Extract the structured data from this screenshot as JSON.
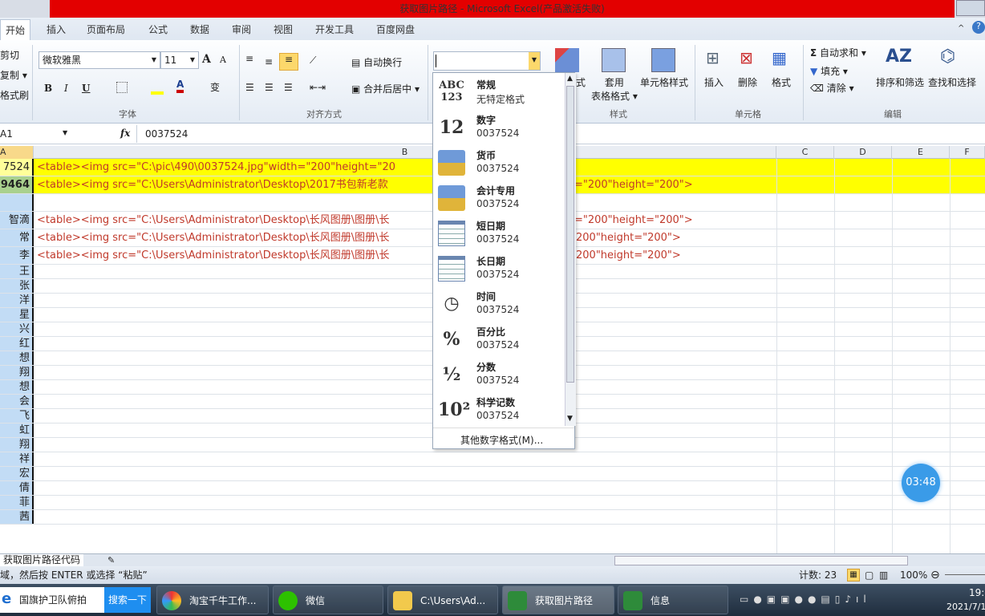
{
  "window": {
    "title": "获取图片路径 - Microsoft Excel(产品激活失败)"
  },
  "tabs": [
    "开始",
    "插入",
    "页面布局",
    "公式",
    "数据",
    "审阅",
    "视图",
    "开发工具",
    "百度网盘"
  ],
  "ribbon": {
    "clipboard": {
      "cut": "剪切",
      "copy": "复制 ▾",
      "format_painter": "格式刷"
    },
    "font": {
      "name": "微软雅黑",
      "size": "11",
      "group": "字体",
      "bold": "B",
      "italic": "I",
      "underline": "U"
    },
    "alignment": {
      "wrap": "自动换行",
      "merge": "合并后居中 ▾",
      "group": "对齐方式"
    },
    "number": {
      "format_value": ""
    },
    "styles": {
      "conditional": "式",
      "table": "套用\n表格格式 ▾",
      "cell": "单元格样式",
      "group": "样式"
    },
    "cells": {
      "insert": "插入",
      "delete": "删除",
      "format": "格式",
      "group": "单元格"
    },
    "editing": {
      "autosum": "自动求和 ▾",
      "fill": "填充 ▾",
      "clear": "清除 ▾",
      "sort": "排序和筛选",
      "find": "查找和选择",
      "group": "编辑"
    }
  },
  "formula_bar": {
    "name_box": "A1",
    "fx": "fx",
    "value": "0037524"
  },
  "columns": [
    "A",
    "B",
    "C",
    "D",
    "E",
    "F"
  ],
  "rows": [
    {
      "a": "7524",
      "b": "<table><img src=\"C:\\pic\\490\\0037524.jpg\"width=\"200\"height=\"20",
      "hl": true
    },
    {
      "a": "9464",
      "b": "<table><img src=\"C:\\Users\\Administrator\\Desktop\\2017书包新老款",
      "b2": "=\"200\"height=\"200\">",
      "hl": true
    },
    {
      "a": "",
      "b": ""
    },
    {
      "a": "智滴",
      "b": "<table><img src=\"C:\\Users\\Administrator\\Desktop\\长风图册\\图册\\长",
      "b2": "=\"200\"height=\"200\">"
    },
    {
      "a": "常",
      "b": "<table><img src=\"C:\\Users\\Administrator\\Desktop\\长风图册\\图册\\长",
      "b2": "200\"height=\"200\">"
    },
    {
      "a": "李",
      "b": "<table><img src=\"C:\\Users\\Administrator\\Desktop\\长风图册\\图册\\长",
      "b2": "200\"height=\"200\">"
    },
    {
      "a": "王"
    },
    {
      "a": "张"
    },
    {
      "a": "洋"
    },
    {
      "a": "星"
    },
    {
      "a": "兴"
    },
    {
      "a": "红"
    },
    {
      "a": "想"
    },
    {
      "a": "翔"
    },
    {
      "a": "想"
    },
    {
      "a": "会"
    },
    {
      "a": "飞"
    },
    {
      "a": "虹"
    },
    {
      "a": "翔"
    },
    {
      "a": "祥"
    },
    {
      "a": "宏"
    },
    {
      "a": "倩"
    },
    {
      "a": "菲"
    },
    {
      "a": "茜"
    }
  ],
  "number_format_menu": {
    "items": [
      {
        "icon": "ABC\n123",
        "name": "常规",
        "value": "无特定格式"
      },
      {
        "icon": "12",
        "name": "数字",
        "value": "0037524"
      },
      {
        "icon": "currency-icon",
        "name": "货币",
        "value": "0037524"
      },
      {
        "icon": "accounting-icon",
        "name": "会计专用",
        "value": " 0037524"
      },
      {
        "icon": "calendar-icon",
        "name": "短日期",
        "value": "0037524"
      },
      {
        "icon": "calendar-icon",
        "name": "长日期",
        "value": "0037524"
      },
      {
        "icon": "clock-icon",
        "name": "时间",
        "value": "0037524"
      },
      {
        "icon": "%",
        "name": "百分比",
        "value": "0037524"
      },
      {
        "icon": "½",
        "name": "分数",
        "value": "0037524"
      },
      {
        "icon": "10²",
        "name": "科学记数",
        "value": "0037524"
      }
    ],
    "more": "其他数字格式(M)..."
  },
  "sheet_tab": "获取图片路径代码",
  "status": {
    "message": "域，然后按 ENTER 或选择 “粘贴”",
    "count": "计数: 23",
    "zoom": "100%"
  },
  "timer": "03:48",
  "taskbar": {
    "search_text": "国旗护卫队俯拍",
    "search_button": "搜索一下",
    "items": [
      "淘宝千牛工作...",
      "微信",
      "C:\\Users\\Ad...",
      "获取图片路径",
      "信息"
    ],
    "clock": "19:",
    "date": "2021/7/1"
  },
  "colors": {
    "title_red": "#e30000",
    "highlight_yellow": "#ffff00",
    "text_red": "#c0392b",
    "column_a": "#c2dcf5"
  }
}
